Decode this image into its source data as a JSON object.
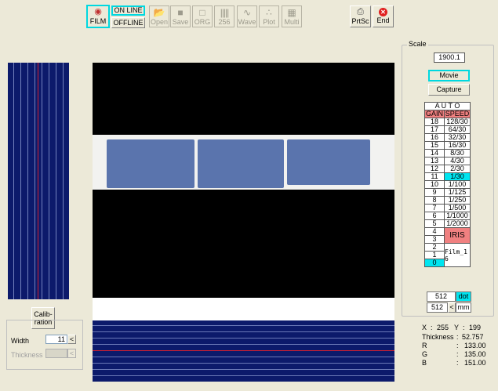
{
  "toolbar": {
    "film": "FILM",
    "online": "ON LINE",
    "offline": "OFFLINE",
    "open": "Open",
    "save": "Save",
    "org": "ORG",
    "b256": "256",
    "wave": "Wave",
    "plot": "Plot",
    "multi": "Multi",
    "prtsc": "PrtSc",
    "end": "End"
  },
  "scale": {
    "legend": "Scale",
    "value": "1900.1",
    "movie": "Movie",
    "capture": "Capture"
  },
  "auto_table": {
    "title": "A U T O",
    "gain_header": "GAIN",
    "speed_header": "SPEED",
    "rows": [
      {
        "gain": "18",
        "speed": "128/30"
      },
      {
        "gain": "17",
        "speed": "64/30"
      },
      {
        "gain": "16",
        "speed": "32/30"
      },
      {
        "gain": "15",
        "speed": "16/30"
      },
      {
        "gain": "14",
        "speed": "8/30"
      },
      {
        "gain": "13",
        "speed": "4/30"
      },
      {
        "gain": "12",
        "speed": "2/30"
      },
      {
        "gain": "11",
        "speed": "1/30"
      },
      {
        "gain": "10",
        "speed": "1/100"
      },
      {
        "gain": "9",
        "speed": "1/125"
      },
      {
        "gain": "8",
        "speed": "1/250"
      },
      {
        "gain": "7",
        "speed": "1/500"
      },
      {
        "gain": "6",
        "speed": "1/1000"
      },
      {
        "gain": "5",
        "speed": "1/2000"
      }
    ],
    "low_gains": [
      "4",
      "3",
      "2",
      "1",
      "0"
    ],
    "iris": "IRIS",
    "film_name": "Film_1 6"
  },
  "size": {
    "w": "512",
    "h": "512",
    "dot": "dot",
    "mm": "mm",
    "arrow": "<"
  },
  "calibration": {
    "button": "Calib- ration",
    "width_label": "Width",
    "width_value": "11",
    "thickness_label": "Thickness",
    "arrow": "<"
  },
  "readout": {
    "x_label": "X",
    "x_value": "255",
    "y_label": "Y",
    "y_value": "199",
    "thickness_label": "Thickness",
    "thickness_value": "52.757",
    "r_label": "R",
    "r_value": "133.00",
    "g_label": "G",
    "g_value": "135.00",
    "b_label": "B",
    "b_value": "151.00"
  },
  "colors": {
    "selected_speed": "#00e5f0",
    "header": "#f08080",
    "iris": "#f08080",
    "gain_zero": "#00e5f0",
    "stripe_bg": "#0c1a6b"
  }
}
